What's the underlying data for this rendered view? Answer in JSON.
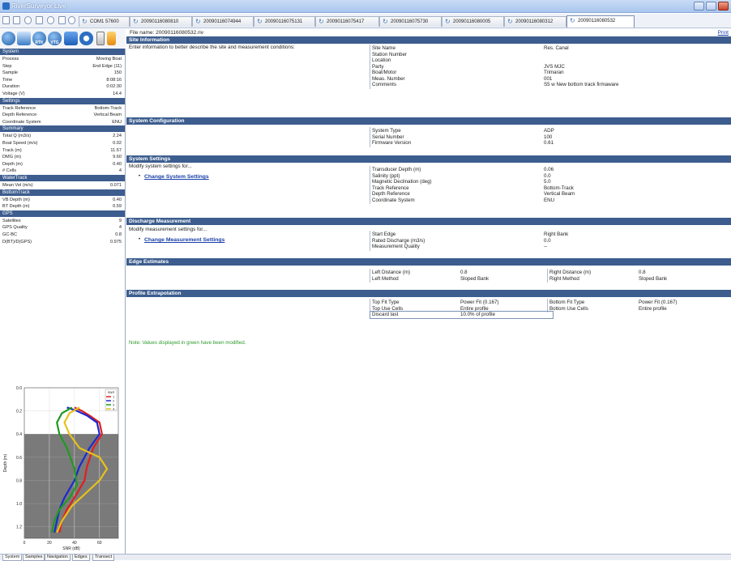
{
  "window": {
    "title": "RiverSurveyor Live"
  },
  "tabs": [
    "COM1 57600",
    "20090116080810",
    "20090116074944",
    "20090116075131",
    "20090116075417",
    "20090116075730",
    "20090116080005",
    "20090116080312",
    "20090116080532"
  ],
  "icons": {
    "rtk": "RTK",
    "vtg": "VTG"
  },
  "left": {
    "system": {
      "title": "System",
      "rows": [
        [
          "Process",
          "Moving Boat"
        ],
        [
          "Step",
          "End Edge (11)"
        ],
        [
          "Sample",
          "150"
        ],
        [
          "Time",
          "8:08:16"
        ],
        [
          "Duration",
          "0:02:30"
        ],
        [
          "Voltage (V)",
          "14.4"
        ]
      ]
    },
    "settings": {
      "title": "Settings",
      "rows": [
        [
          "Track Reference",
          "Bottom-Track"
        ],
        [
          "Depth Reference",
          "Vertical Beam"
        ],
        [
          "Coordinate System",
          "ENU"
        ]
      ]
    },
    "summary": {
      "title": "Summary",
      "rows": [
        [
          "Total Q (m3/s)",
          "2.24"
        ],
        [
          "Boat Speed (m/s)",
          "0.02"
        ],
        [
          "Track (m)",
          "11.57"
        ],
        [
          "DMG (m)",
          "9.60"
        ],
        [
          "Depth (m)",
          "0.40"
        ],
        [
          "# Cells",
          "4"
        ]
      ]
    },
    "watertrack": {
      "title": "WaterTrack",
      "rows": [
        [
          "Mean Vel (m/s)",
          "0.071"
        ]
      ]
    },
    "bottomtrack": {
      "title": "BottomTrack",
      "rows": [
        [
          "VB Depth (m)",
          "0.40"
        ],
        [
          "BT Depth (m)",
          "0.59"
        ]
      ]
    },
    "gps": {
      "title": "GPS",
      "rows": [
        [
          "Satellites",
          "9"
        ],
        [
          "GPS Quality",
          "4"
        ],
        [
          "GC-BC",
          "0.8"
        ],
        [
          "D(BT)/D(GPS)",
          "0.975"
        ]
      ]
    }
  },
  "profile_chart": {
    "xlabel": "SNR (dB)",
    "ylabel": "Depth (m)",
    "legend_title": "SNR",
    "xticks": [
      "0",
      "20",
      "40",
      "60"
    ],
    "yticks": [
      "0.0",
      "0.2",
      "0.4",
      "0.6",
      "0.8",
      "1.0",
      "1.2"
    ],
    "series_names": [
      "1",
      "2",
      "3",
      "4"
    ],
    "colors": [
      "#e02020",
      "#1a2ad0",
      "#1f9a1f",
      "#e6c21a"
    ]
  },
  "chart_data": {
    "type": "line",
    "xlabel": "SNR (dB)",
    "ylabel": "Depth (m)",
    "xlim": [
      0,
      75
    ],
    "ylim": [
      0,
      1.3
    ],
    "shaded_below_depth": 0.4,
    "series": [
      {
        "name": "1",
        "points": [
          [
            40,
            0.17
          ],
          [
            46,
            0.2
          ],
          [
            52,
            0.24
          ],
          [
            60,
            0.3
          ],
          [
            62,
            0.4
          ],
          [
            55,
            0.52
          ],
          [
            50,
            0.68
          ],
          [
            48,
            0.8
          ],
          [
            40,
            0.95
          ],
          [
            34,
            1.05
          ],
          [
            30,
            1.15
          ],
          [
            28,
            1.25
          ]
        ]
      },
      {
        "name": "2",
        "points": [
          [
            34,
            0.17
          ],
          [
            42,
            0.2
          ],
          [
            50,
            0.24
          ],
          [
            58,
            0.3
          ],
          [
            60,
            0.4
          ],
          [
            52,
            0.52
          ],
          [
            44,
            0.68
          ],
          [
            40,
            0.8
          ],
          [
            32,
            0.95
          ],
          [
            28,
            1.05
          ],
          [
            26,
            1.15
          ],
          [
            24,
            1.25
          ]
        ]
      },
      {
        "name": "3",
        "points": [
          [
            38,
            0.17
          ],
          [
            30,
            0.22
          ],
          [
            26,
            0.3
          ],
          [
            28,
            0.4
          ],
          [
            34,
            0.52
          ],
          [
            40,
            0.7
          ],
          [
            42,
            0.84
          ],
          [
            36,
            0.95
          ],
          [
            28,
            1.05
          ],
          [
            24,
            1.15
          ],
          [
            22,
            1.25
          ]
        ]
      },
      {
        "name": "4",
        "points": [
          [
            44,
            0.17
          ],
          [
            36,
            0.22
          ],
          [
            32,
            0.3
          ],
          [
            36,
            0.4
          ],
          [
            44,
            0.52
          ],
          [
            60,
            0.6
          ],
          [
            66,
            0.7
          ],
          [
            60,
            0.8
          ],
          [
            48,
            0.92
          ],
          [
            38,
            1.02
          ],
          [
            30,
            1.15
          ],
          [
            26,
            1.25
          ]
        ]
      }
    ]
  },
  "main": {
    "filename": "File name: 20090116080532.riv",
    "print": "Print",
    "site": {
      "title": "Site Information",
      "desc": "Enter information to better describe the site and measurement conditions:",
      "rows": [
        [
          "Site Name",
          "Res. Canal"
        ],
        [
          "Station Number",
          ""
        ],
        [
          "Location",
          ""
        ],
        [
          "Party",
          "JVS MJC"
        ],
        [
          "Boat/Motor",
          "Trimaran"
        ],
        [
          "Meas. Number",
          "001"
        ],
        [
          "Comments",
          "S5 w New bottom track firmaware"
        ]
      ]
    },
    "sysconfig": {
      "title": "System Configuration",
      "rows": [
        [
          "System Type",
          "ADP"
        ],
        [
          "Serial Number",
          "100"
        ],
        [
          "Firmware Version",
          "0.61"
        ]
      ]
    },
    "syssettings": {
      "title": "System Settings",
      "desc": "Modify system settings for...",
      "link": "Change System Settings",
      "rows": [
        [
          "Transducer Depth (m)",
          "0.06"
        ],
        [
          "Salinity (ppt)",
          "0.0"
        ],
        [
          "Magnetic Declination (deg)",
          "5.0"
        ],
        [
          "Track Reference",
          "Bottom-Track"
        ],
        [
          "Depth Reference",
          "Vertical Beam"
        ],
        [
          "Coordinate System",
          "ENU"
        ]
      ]
    },
    "discharge": {
      "title": "Discharge Measurement",
      "desc": "Modify measurement settings for...",
      "link": "Change Measurement Settings",
      "rows": [
        [
          "Start Edge",
          "Right Bank"
        ],
        [
          "Rated Discharge (m3/s)",
          "0.0"
        ],
        [
          "Measurement Quality",
          "--"
        ]
      ]
    },
    "edge": {
      "title": "Edge Estimates",
      "left": [
        [
          "Left Distance (m)",
          "0.8"
        ],
        [
          "Left Method",
          "Sloped Bank"
        ]
      ],
      "right": [
        [
          "Right Distance (m)",
          "0.8"
        ],
        [
          "Right Method",
          "Sloped Bank"
        ]
      ]
    },
    "profile": {
      "title": "Profile Extrapolation",
      "left": [
        [
          "Top Fit Type",
          "Power Fit (0.167)"
        ],
        [
          "Top Use Cells",
          "Entire profile"
        ],
        [
          "Discard last",
          "10.0% of profile"
        ]
      ],
      "right": [
        [
          "Bottom Fit Type",
          "Power Fit (0.167)"
        ],
        [
          "Bottom Use Cells",
          "Entire profile"
        ]
      ]
    },
    "note": "Note: Values displayed in green have been modified."
  },
  "bottom_tabs": [
    "System",
    "Samples",
    "Navigation",
    "Edges",
    "Transect"
  ]
}
